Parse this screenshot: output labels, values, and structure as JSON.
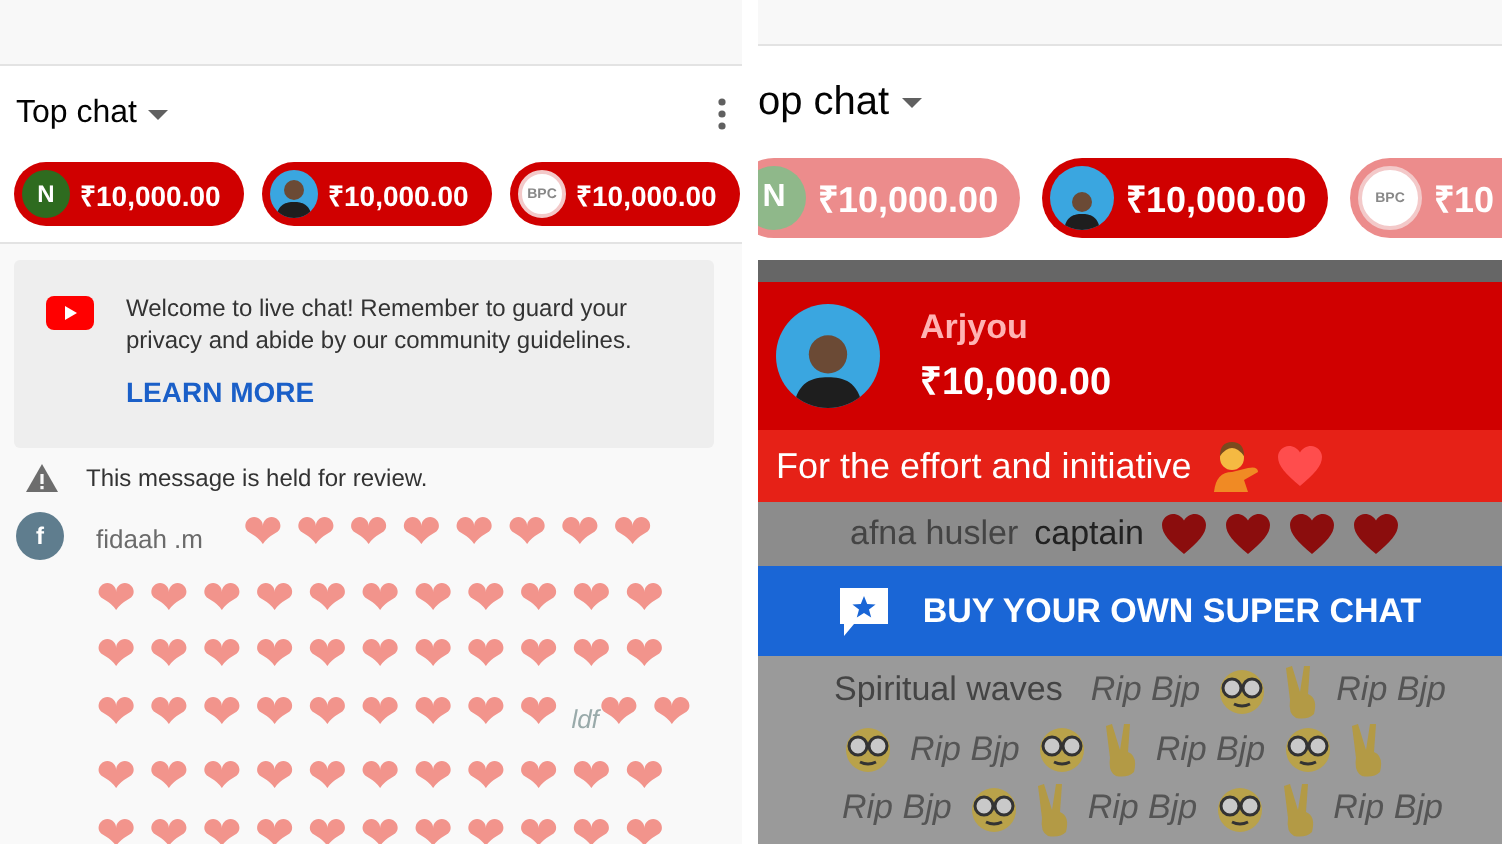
{
  "left_panel": {
    "chat_mode": "Top chat",
    "chips": [
      {
        "avatar": {
          "kind": "letter",
          "text": "N",
          "color": "#2e6b1f"
        },
        "amount": "₹10,000.00",
        "dimmed": false
      },
      {
        "avatar": {
          "kind": "photo"
        },
        "amount": "₹10,000.00",
        "dimmed": false
      },
      {
        "avatar": {
          "kind": "logo",
          "text": "BPC"
        },
        "amount": "₹10,000.00",
        "dimmed": false
      }
    ],
    "welcome": {
      "text": "Welcome to live chat! Remember to guard your privacy and abide by our community guidelines.",
      "link": "LEARN MORE"
    },
    "held_notice": "This message is held for review.",
    "message": {
      "author": "fidaah .m",
      "avatar": {
        "kind": "letter",
        "text": "f",
        "color": "#5f7d8e"
      },
      "text": "❤❤❤❤❤❤❤❤❤❤❤❤❤❤❤❤❤❤❤❤❤❤❤❤❤❤❤❤❤❤❤❤❤❤❤❤❤❤❤*ldf*❤❤❤❤❤❤❤❤❤❤❤❤❤❤❤❤❤❤❤❤❤❤❤❤"
    }
  },
  "right_panel": {
    "chat_mode": "op chat",
    "chips": [
      {
        "avatar": {
          "kind": "letter",
          "text": "N",
          "color": "#8fb88a"
        },
        "amount": "₹10,000.00",
        "dimmed": true
      },
      {
        "avatar": {
          "kind": "photo"
        },
        "amount": "₹10,000.00",
        "dimmed": false
      },
      {
        "avatar": {
          "kind": "logo",
          "text": "BPC"
        },
        "amount": "₹10",
        "dimmed": true
      }
    ],
    "super_chat": {
      "author": "Arjyou",
      "amount": "₹10,000.00",
      "message": "For the effort and initiative",
      "emojis": [
        {
          "kind": "tipping-hand"
        },
        {
          "kind": "heart"
        }
      ]
    },
    "chat_behind": [
      {
        "author": "afna husler",
        "parts": [
          {
            "kind": "text",
            "text": "captain"
          },
          {
            "kind": "heart"
          },
          {
            "kind": "heart"
          },
          {
            "kind": "heart"
          },
          {
            "kind": "heart"
          }
        ]
      }
    ],
    "buy_button": "BUY YOUR OWN SUPER CHAT",
    "chat_below": [
      {
        "author": "Spiritual waves",
        "parts": [
          {
            "kind": "text",
            "text": "Rip Bjp"
          },
          {
            "kind": "glasses"
          },
          {
            "kind": "victory"
          },
          {
            "kind": "text",
            "text": "Rip Bjp"
          },
          {
            "kind": "glasses"
          },
          {
            "kind": "text",
            "text": "Rip Bjp"
          },
          {
            "kind": "glasses"
          },
          {
            "kind": "victory"
          },
          {
            "kind": "text",
            "text": "Rip Bjp"
          },
          {
            "kind": "glasses"
          },
          {
            "kind": "victory"
          },
          {
            "kind": "text",
            "text": "Rip Bjp"
          },
          {
            "kind": "glasses"
          },
          {
            "kind": "victory"
          },
          {
            "kind": "text",
            "text": "Rip Bjp"
          },
          {
            "kind": "glasses"
          },
          {
            "kind": "victory"
          },
          {
            "kind": "text",
            "text": "Rip Bjp"
          }
        ]
      }
    ]
  }
}
